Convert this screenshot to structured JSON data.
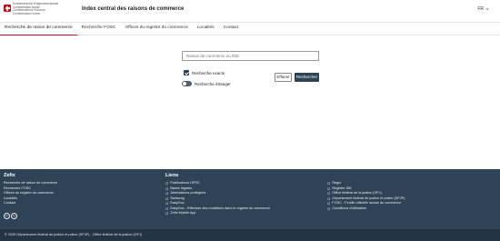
{
  "header": {
    "confederation": [
      "Schweizerische Eidgenossenschaft",
      "Confédération suisse",
      "Confederazione Svizzera",
      "Confederaziun svizra"
    ],
    "title": "Index central des raisons de commerce",
    "language": "FR"
  },
  "nav": {
    "tabs": [
      {
        "label": "Recherche de raison de commerce"
      },
      {
        "label": "Recherche FOSC"
      },
      {
        "label": "Offices du registre du commerce"
      },
      {
        "label": "Localités"
      },
      {
        "label": "Contact"
      }
    ]
  },
  "search": {
    "placeholder": "Raison de commerce ou IDE",
    "exact_label": "Recherche exacte",
    "foreign_label": "Recherche étranger",
    "clear_label": "Effacer",
    "search_label": "Rechercher"
  },
  "footer": {
    "zefix": {
      "title": "Zefix",
      "items": [
        "Recherche de raison de commerce",
        "Recherche FOSC",
        "Offices du registre du commerce",
        "Localités",
        "Contact"
      ],
      "badges": [
        "cc",
        "by"
      ]
    },
    "links": {
      "title": "Liens",
      "col1": [
        "Publications OFRC",
        "Bases légales",
        "Abréviations protégées",
        "Swissreg",
        "EasyGov",
        "EasyGov - Effectuer des mutations dans le registre du commerce",
        "Zefix Mobile App"
      ],
      "col2": [
        "Regix",
        "Registre IDE",
        "Office fédéral de la justice (OFJ)",
        "Département fédéral de justice et police (DFJP)",
        "FOSC - Feuille officielle suisse du commerce",
        "Conditions d'utilisation"
      ]
    },
    "copyright": "© 2025 Département fédéral de justice et police (DFJP) - Office fédéral de la justice (OFJ)"
  },
  "colors": {
    "accent": "#dc0018",
    "footer_bg": "#2f4356",
    "footer_bottom_bg": "#243444"
  }
}
